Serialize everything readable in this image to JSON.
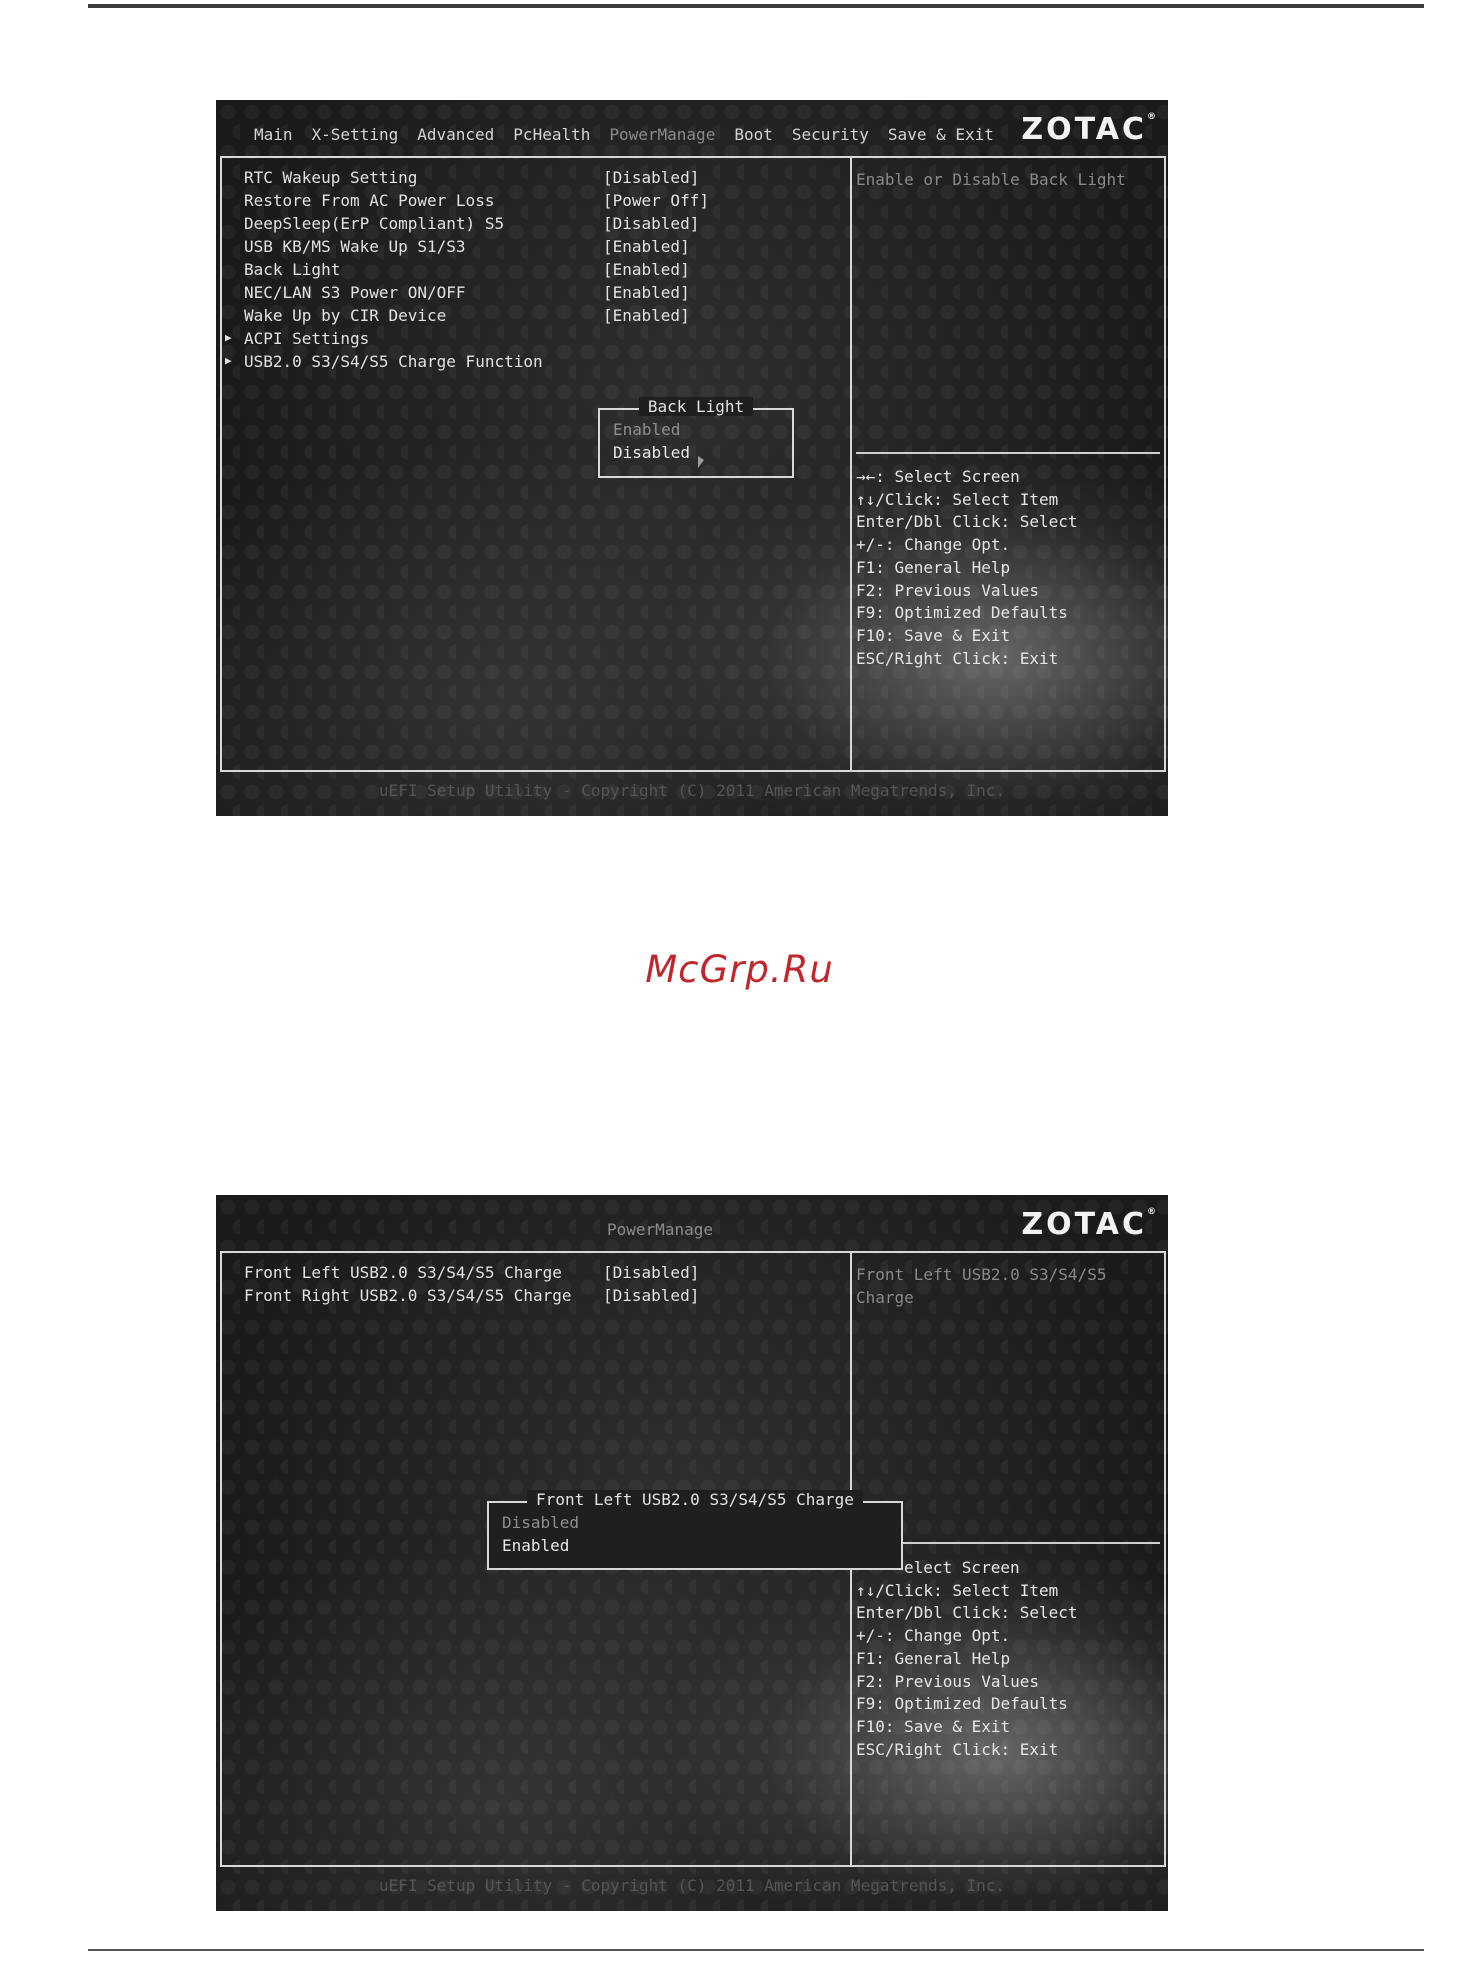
{
  "screen_a": {
    "tabs": [
      "Main",
      "X-Setting",
      "Advanced",
      "PcHealth",
      "PowerManage",
      "Boot",
      "Security",
      "Save & Exit"
    ],
    "active_tab": "PowerManage",
    "logo": "ZOTAC",
    "settings": [
      {
        "label": "RTC Wakeup Setting",
        "value": "[Disabled]"
      },
      {
        "label": "Restore From AC Power Loss",
        "value": "[Power Off]"
      },
      {
        "label": "DeepSleep(ErP Compliant) S5",
        "value": "[Disabled]"
      },
      {
        "label": "USB KB/MS Wake Up S1/S3",
        "value": "[Enabled]"
      },
      {
        "label": "Back Light",
        "value": "[Enabled]"
      },
      {
        "label": "NEC/LAN S3 Power ON/OFF",
        "value": "[Enabled]"
      },
      {
        "label": "Wake Up by CIR Device",
        "value": "[Enabled]"
      }
    ],
    "submenus": [
      "ACPI Settings",
      "USB2.0 S3/S4/S5 Charge Function"
    ],
    "help": "Enable or Disable Back Light",
    "popup": {
      "title": "Back Light",
      "options": [
        "Enabled",
        "Disabled"
      ]
    },
    "keys": [
      "→←: Select Screen",
      "↑↓/Click: Select Item",
      "Enter/Dbl Click: Select",
      "+/-: Change Opt.",
      "F1: General Help",
      "F2: Previous Values",
      "F9: Optimized Defaults",
      "F10: Save & Exit",
      "ESC/Right Click: Exit"
    ],
    "footer": "uEFI Setup Utility - Copyright (C) 2011 American Megatrends, Inc."
  },
  "screen_b": {
    "title": "PowerManage",
    "logo": "ZOTAC",
    "settings": [
      {
        "label": "Front Left USB2.0 S3/S4/S5 Charge",
        "value": "[Disabled]"
      },
      {
        "label": "Front Right USB2.0 S3/S4/S5 Charge",
        "value": "[Disabled]"
      }
    ],
    "help": "Front Left USB2.0 S3/S4/S5 Charge",
    "popup": {
      "title": "Front Left USB2.0 S3/S4/S5 Charge",
      "options": [
        "Disabled",
        "Enabled"
      ]
    },
    "keys": [
      "elect Screen",
      "↑↓/Click: Select Item",
      "Enter/Dbl Click: Select",
      "+/-: Change Opt.",
      "F1: General Help",
      "F2: Previous Values",
      "F9: Optimized Defaults",
      "F10: Save & Exit",
      "ESC/Right Click: Exit"
    ],
    "footer": "uEFI Setup Utility - Copyright (C) 2011 American Megatrends, Inc."
  },
  "watermark": "McGrp.Ru"
}
